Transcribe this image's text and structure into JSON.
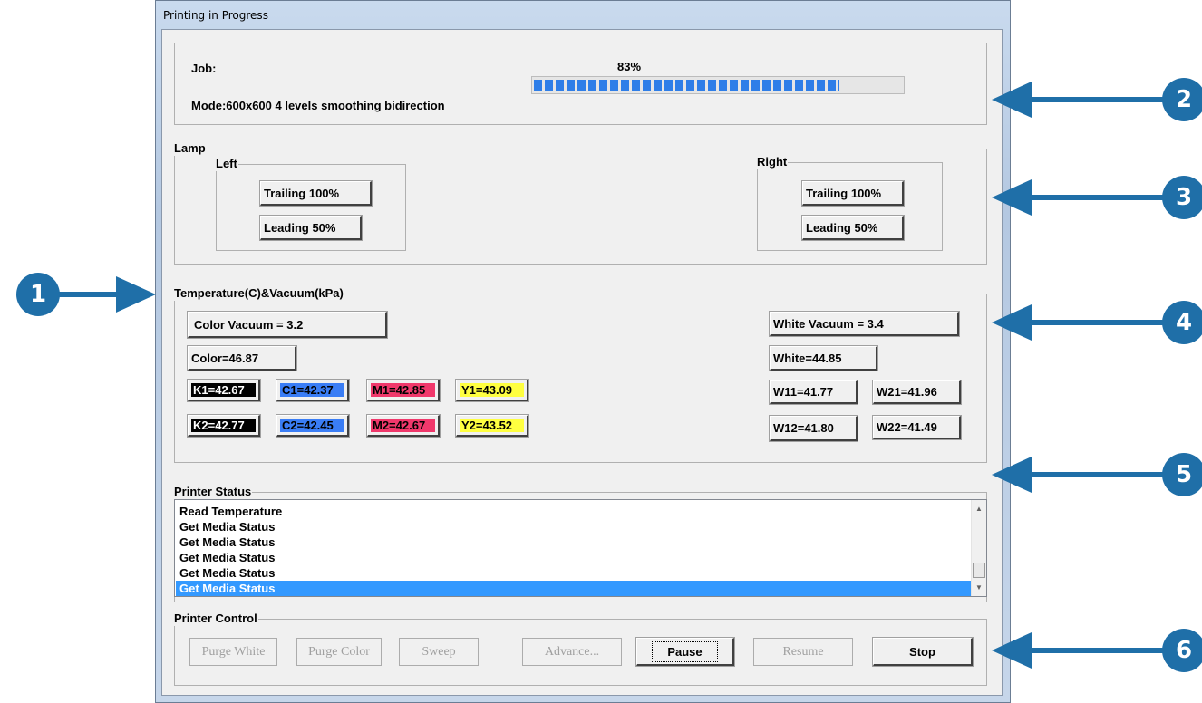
{
  "window": {
    "title": "Printing in Progress"
  },
  "job": {
    "label": "Job:",
    "progress_text": "83%",
    "progress_fraction": 0.83,
    "mode": "Mode:600x600 4 levels smoothing bidirection"
  },
  "lamp": {
    "title": "Lamp",
    "left": {
      "title": "Left",
      "trailing": "Trailing 100%",
      "leading": "Leading 50%"
    },
    "right": {
      "title": "Right",
      "trailing": "Trailing 100%",
      "leading": "Leading 50%"
    }
  },
  "temperature": {
    "title": "Temperature(C)&Vacuum(kPa)",
    "color_vacuum": "Color Vacuum = 3.2",
    "color_temp": "Color=46.87",
    "white_vacuum": "White Vacuum = 3.4",
    "white_temp": "White=44.85",
    "heads": {
      "k1": "K1=42.67",
      "c1": "C1=42.37",
      "m1": "M1=42.85",
      "y1": "Y1=43.09",
      "k2": "K2=42.77",
      "c2": "C2=42.45",
      "m2": "M2=42.67",
      "y2": "Y2=43.52",
      "w11": "W11=41.77",
      "w21": "W21=41.96",
      "w12": "W12=41.80",
      "w22": "W22=41.49"
    },
    "colors": {
      "k": "#000000",
      "c": "#3a7df5",
      "m": "#f0386b",
      "y": "#ffff40"
    }
  },
  "status": {
    "title": "Printer Status",
    "items": [
      "Read Temperature",
      "Get Media Status",
      "Get Media Status",
      "Get Media Status",
      "Get Media Status",
      "Get Media Status"
    ],
    "selected_index": 5
  },
  "control": {
    "title": "Printer Control",
    "purge_white": "Purge White",
    "purge_color": "Purge Color",
    "sweep": "Sweep",
    "advance": "Advance...",
    "pause": "Pause",
    "resume": "Resume",
    "stop": "Stop"
  },
  "callouts": {
    "c1": "1",
    "c2": "2",
    "c3": "3",
    "c4": "4",
    "c5": "5",
    "c6": "6"
  }
}
